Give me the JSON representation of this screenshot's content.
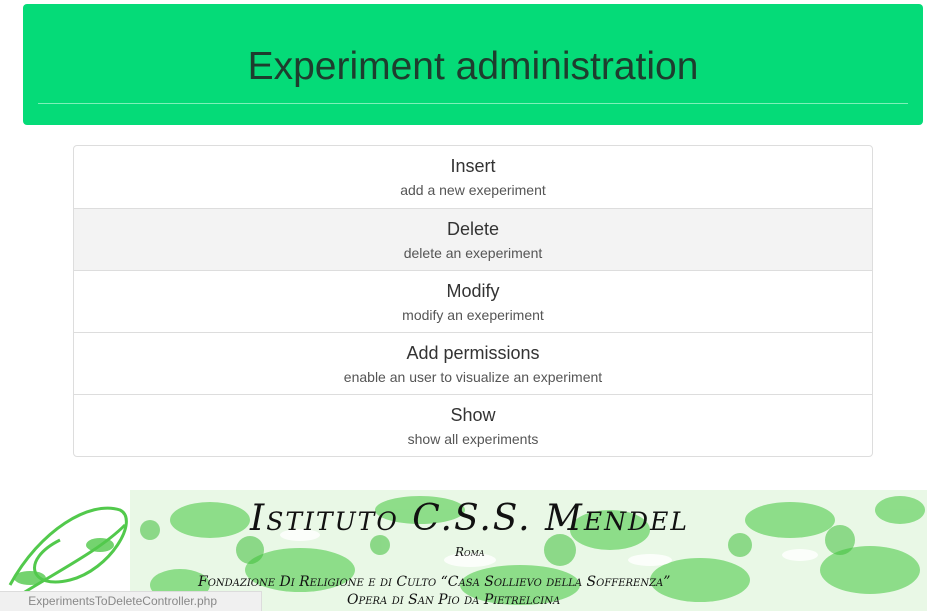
{
  "header": {
    "title": "Experiment administration"
  },
  "menu": {
    "items": [
      {
        "title": "Insert",
        "description": "add a new exeperiment"
      },
      {
        "title": "Delete",
        "description": "delete an exeperiment"
      },
      {
        "title": "Modify",
        "description": "modify an exeperiment"
      },
      {
        "title": "Add permissions",
        "description": "enable an user to visualize an experiment"
      },
      {
        "title": "Show",
        "description": "show all experiments"
      }
    ],
    "hovered_index": 1
  },
  "banner": {
    "title": "Istituto C.S.S. Mendel",
    "city": "Roma",
    "line1": "Fondazione Di Religione e di Culto “Casa Sollievo della Sofferenza”",
    "line2": "Opera di San Pio da Pietrelcina"
  },
  "status_bar": {
    "url": "ExperimentsToDeleteController.php"
  },
  "colors": {
    "header_bg": "#05db78",
    "banner_green": "#5fd35f"
  }
}
